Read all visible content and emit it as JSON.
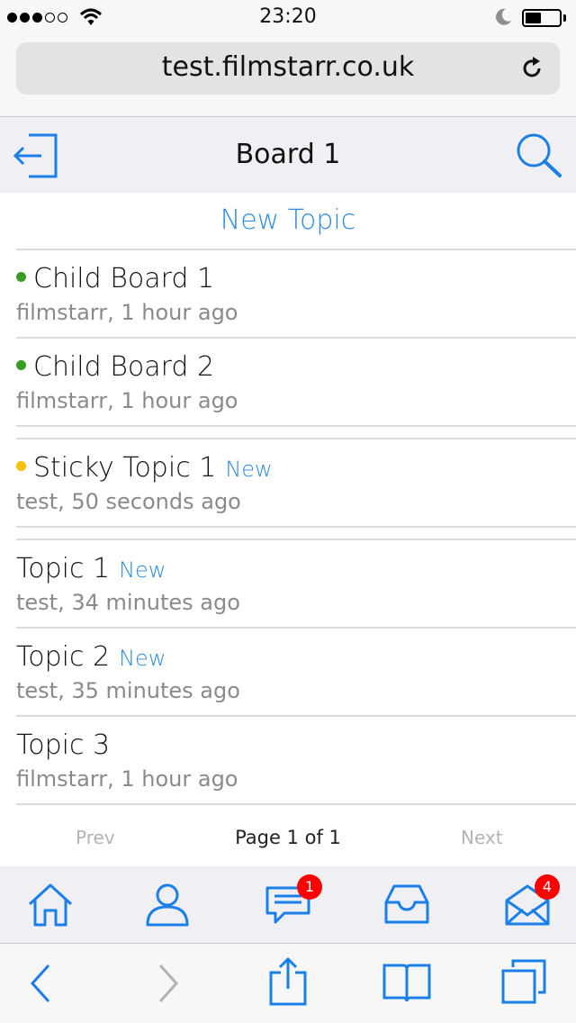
{
  "status_bar": {
    "time": "23:20"
  },
  "browser": {
    "url": "test.filmstarr.co.uk"
  },
  "header": {
    "title": "Board 1"
  },
  "new_topic_label": "New Topic",
  "list": [
    {
      "title": "Child Board 1",
      "meta": "filmstarr, 1 hour ago",
      "dot_color": "#3a9d23",
      "new_label": ""
    },
    {
      "title": "Child Board 2",
      "meta": "filmstarr, 1 hour ago",
      "dot_color": "#3a9d23",
      "new_label": ""
    },
    {
      "title": "Sticky Topic 1",
      "meta": "test, 50 seconds ago",
      "dot_color": "#f5c000",
      "new_label": "New"
    },
    {
      "title": "Topic 1",
      "meta": "test, 34 minutes ago",
      "dot_color": "",
      "new_label": "New"
    },
    {
      "title": "Topic 2",
      "meta": "test, 35 minutes ago",
      "dot_color": "",
      "new_label": "New"
    },
    {
      "title": "Topic 3",
      "meta": "filmstarr, 1 hour ago",
      "dot_color": "",
      "new_label": ""
    }
  ],
  "pagination": {
    "prev": "Prev",
    "page_info": "Page 1 of 1",
    "next": "Next"
  },
  "tabbar": {
    "items": [
      {
        "icon": "home-icon"
      },
      {
        "icon": "profile-icon"
      },
      {
        "icon": "messages-icon",
        "badge": "1"
      },
      {
        "icon": "inbox-icon"
      },
      {
        "icon": "mail-icon",
        "badge": "4"
      }
    ]
  },
  "colors": {
    "accent": "#2a8ae2",
    "online": "#3a9d23",
    "sticky": "#f5c000",
    "badge": "#ff0000"
  }
}
